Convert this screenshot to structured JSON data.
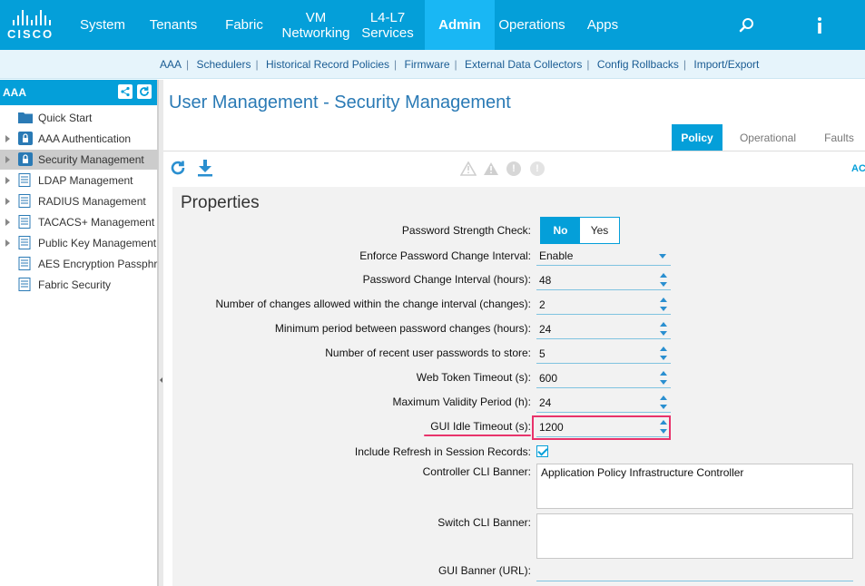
{
  "brand": {
    "logo_text": "CISCO",
    "accent": "#049fd9",
    "active_tab_color": "#19b7f4",
    "highlight_color": "#e8336b"
  },
  "topnav": {
    "items": [
      {
        "label": "System"
      },
      {
        "label": "Tenants"
      },
      {
        "label": "Fabric"
      },
      {
        "label_line1": "VM",
        "label_line2": "Networking"
      },
      {
        "label_line1": "L4-L7",
        "label_line2": "Services"
      },
      {
        "label": "Admin",
        "active": true
      },
      {
        "label": "Operations"
      },
      {
        "label": "Apps"
      }
    ],
    "icons": [
      "search-icon",
      "info-icon"
    ]
  },
  "subnav": {
    "links": [
      "AAA",
      "Schedulers",
      "Historical Record Policies",
      "Firmware",
      "External Data Collectors",
      "Config Rollbacks",
      "Import/Export"
    ],
    "separator": "|"
  },
  "sidebar": {
    "title": "AAA",
    "items": [
      {
        "label": "Quick Start",
        "icon": "folder-icon"
      },
      {
        "label": "AAA Authentication",
        "icon": "lock-icon"
      },
      {
        "label": "Security Management",
        "icon": "lock-icon",
        "selected": true
      },
      {
        "label": "LDAP Management",
        "icon": "document-icon"
      },
      {
        "label": "RADIUS Management",
        "icon": "document-icon"
      },
      {
        "label": "TACACS+ Management",
        "icon": "document-icon"
      },
      {
        "label": "Public Key Management",
        "icon": "document-icon"
      },
      {
        "label": "AES Encryption Passphr",
        "icon": "document-icon"
      },
      {
        "label": "Fabric Security",
        "icon": "document-icon"
      }
    ]
  },
  "main": {
    "title": "User Management - Security Management",
    "tabs": [
      "Policy",
      "Operational",
      "Faults"
    ],
    "active_tab": "Policy",
    "toolbar_right_label": "AC",
    "fault_glyphs": [
      "!",
      "!"
    ],
    "properties": {
      "title": "Properties",
      "password_strength_check": {
        "label": "Password Strength Check:",
        "options": [
          "No",
          "Yes"
        ],
        "selected": "No"
      },
      "enforce_change_interval": {
        "label": "Enforce Password Change Interval:",
        "value": "Enable"
      },
      "change_interval": {
        "label": "Password Change Interval (hours):",
        "value": "48"
      },
      "changes_allowed": {
        "label": "Number of changes allowed within the change interval (changes):",
        "value": "2"
      },
      "min_period": {
        "label": "Minimum period between password changes (hours):",
        "value": "24"
      },
      "recent_passwords": {
        "label": "Number of recent user passwords to store:",
        "value": "5"
      },
      "web_token_timeout": {
        "label": "Web Token Timeout (s):",
        "value": "600"
      },
      "max_validity": {
        "label": "Maximum Validity Period (h):",
        "value": "24"
      },
      "gui_idle_timeout": {
        "label": "GUI Idle Timeout (s):",
        "value": "1200"
      },
      "include_refresh": {
        "label": "Include Refresh in Session Records:",
        "checked": true
      },
      "controller_cli_banner": {
        "label": "Controller CLI Banner:",
        "value": "Application Policy Infrastructure Controller"
      },
      "switch_cli_banner": {
        "label": "Switch CLI Banner:",
        "value": ""
      },
      "gui_banner_url": {
        "label": "GUI Banner (URL):",
        "value": ""
      }
    }
  }
}
